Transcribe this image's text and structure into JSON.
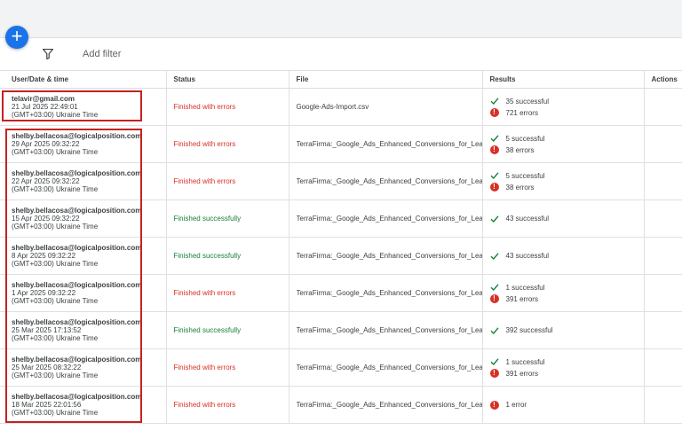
{
  "toolbar": {
    "add_button_icon": "plus-icon",
    "filter_icon": "filter-icon",
    "add_filter_label": "Add filter"
  },
  "table": {
    "headers": [
      "User/Date & time",
      "Status",
      "File",
      "Results",
      "Actions"
    ],
    "rows": [
      {
        "user": "telavir@gmail.com",
        "date": "21 Jul 2025 22:49:01",
        "tz": "(GMT+03:00) Ukraine Time",
        "status": "Finished with errors",
        "status_type": "error",
        "file": "Google-Ads-Import.csv",
        "successful": "35 successful",
        "errors": "721 errors"
      },
      {
        "user": "shelby.bellacosa@logicalposition.com",
        "date": "29 Apr 2025 09:32:22",
        "tz": "(GMT+03:00) Ukraine Time",
        "status": "Finished with errors",
        "status_type": "error",
        "file": "TerraFirma:_Google_Ads_Enhanced_Conversions_for_Leads",
        "successful": "5 successful",
        "errors": "38 errors"
      },
      {
        "user": "shelby.bellacosa@logicalposition.com",
        "date": "22 Apr 2025 09:32:22",
        "tz": "(GMT+03:00) Ukraine Time",
        "status": "Finished with errors",
        "status_type": "error",
        "file": "TerraFirma:_Google_Ads_Enhanced_Conversions_for_Leads",
        "successful": "5 successful",
        "errors": "38 errors"
      },
      {
        "user": "shelby.bellacosa@logicalposition.com",
        "date": "15 Apr 2025 09:32:22",
        "tz": "(GMT+03:00) Ukraine Time",
        "status": "Finished successfully",
        "status_type": "ok",
        "file": "TerraFirma:_Google_Ads_Enhanced_Conversions_for_Leads",
        "successful": "43 successful",
        "errors": null
      },
      {
        "user": "shelby.bellacosa@logicalposition.com",
        "date": "8 Apr 2025 09:32:22",
        "tz": "(GMT+03:00) Ukraine Time",
        "status": "Finished successfully",
        "status_type": "ok",
        "file": "TerraFirma:_Google_Ads_Enhanced_Conversions_for_Leads",
        "successful": "43 successful",
        "errors": null
      },
      {
        "user": "shelby.bellacosa@logicalposition.com",
        "date": "1 Apr 2025 09:32:22",
        "tz": "(GMT+03:00) Ukraine Time",
        "status": "Finished with errors",
        "status_type": "error",
        "file": "TerraFirma:_Google_Ads_Enhanced_Conversions_for_Leads",
        "successful": "1 successful",
        "errors": "391 errors"
      },
      {
        "user": "shelby.bellacosa@logicalposition.com",
        "date": "25 Mar 2025 17:13:52",
        "tz": "(GMT+03:00) Ukraine Time",
        "status": "Finished successfully",
        "status_type": "ok",
        "file": "TerraFirma:_Google_Ads_Enhanced_Conversions_for_Leads",
        "successful": "392 successful",
        "errors": null
      },
      {
        "user": "shelby.bellacosa@logicalposition.com",
        "date": "25 Mar 2025 08:32:22",
        "tz": "(GMT+03:00) Ukraine Time",
        "status": "Finished with errors",
        "status_type": "error",
        "file": "TerraFirma:_Google_Ads_Enhanced_Conversions_for_Leads",
        "successful": "1 successful",
        "errors": "391 errors"
      },
      {
        "user": "shelby.bellacosa@logicalposition.com",
        "date": "18 Mar 2025 22:01:56",
        "tz": "(GMT+03:00) Ukraine Time",
        "status": "Finished with errors",
        "status_type": "error",
        "file": "TerraFirma:_Google_Ads_Enhanced_Conversions_for_Leads",
        "successful": null,
        "errors": "1 error"
      }
    ]
  },
  "colors": {
    "accent": "#1a73e8",
    "error": "#d93025",
    "success": "#188038",
    "highlight": "#c5221f"
  }
}
